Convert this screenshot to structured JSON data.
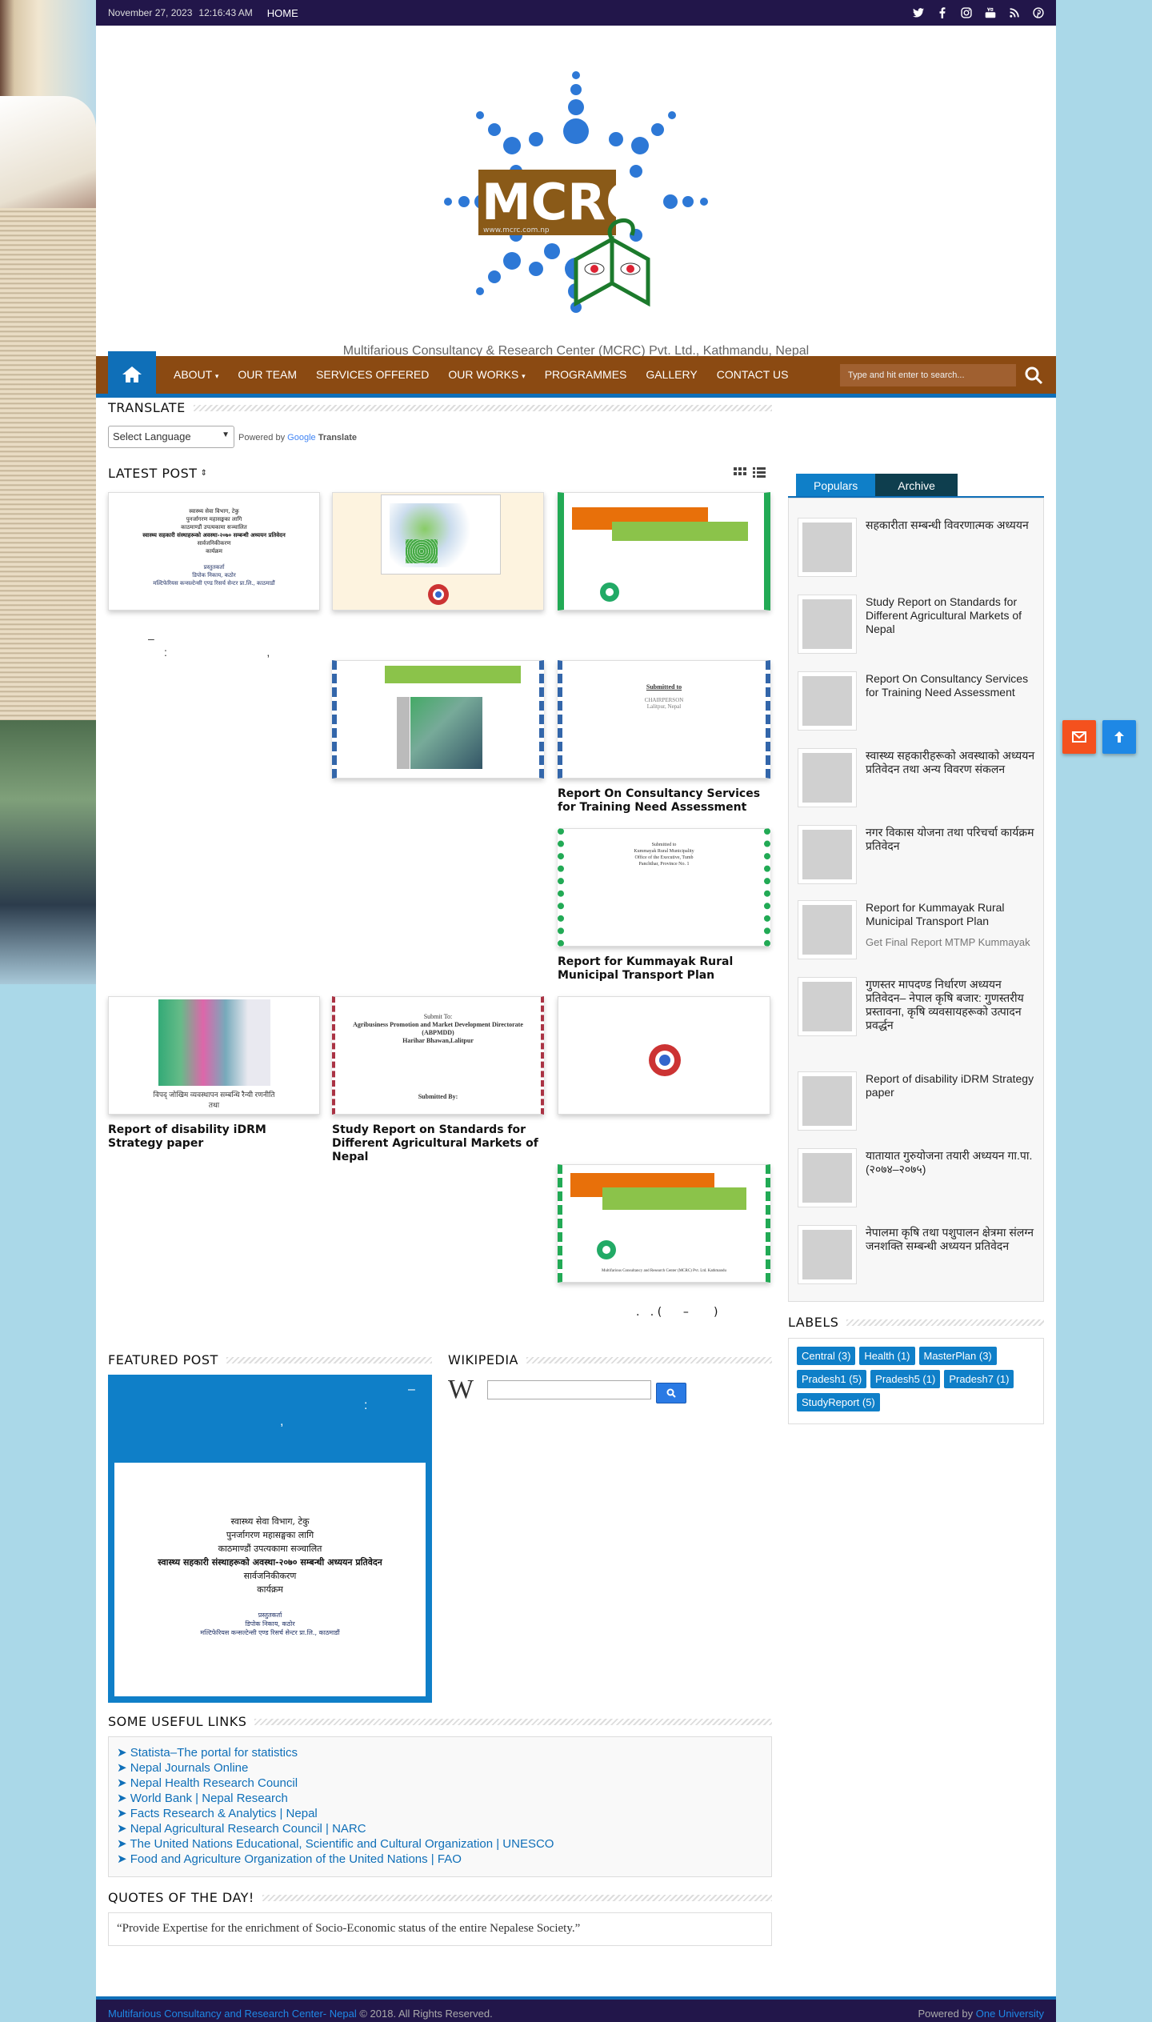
{
  "topbar": {
    "date": "November 27, 2023",
    "time": "12:16:43 AM",
    "home": "HOME"
  },
  "social": [
    "twitter-icon",
    "facebook-icon",
    "instagram-icon",
    "youtube-icon",
    "rss-icon",
    "pinterest-icon"
  ],
  "header": {
    "logo_text": "MCRC",
    "logo_url": "www.mcrc.com.np",
    "tagline": "Multifarious Consultancy & Research Center (MCRC) Pvt. Ltd., Kathmandu, Nepal"
  },
  "nav": {
    "items": [
      "ABOUT",
      "OUR TEAM",
      "SERVICES OFFERED",
      "OUR WORKS",
      "PROGRAMMES",
      "GALLERY",
      "CONTACT US"
    ],
    "search_placeholder": "Type and hit enter to search..."
  },
  "translate": {
    "title": "TRANSLATE",
    "select": "Select Language",
    "powered": "Powered by",
    "google": "Google",
    "translate": "Translate"
  },
  "latest": {
    "title": "LATEST POST"
  },
  "posts": {
    "p1_dash": "–",
    "p1_text": ":                                ,",
    "p5": "Report On Consultancy Services for Training Need Assessment",
    "p6": "Report for Kummayak Rural Municipal Transport Plan",
    "p7": "Report of disability iDRM Strategy paper",
    "p8": "Study Report on Standards for Different Agricultural Markets of Nepal",
    "p10": ".   . (      –       )"
  },
  "doc": {
    "h1": "स्वास्थ्य सेवा विभाग, टेकु",
    "h2": "पुनर्जागरण महासङ्घका लागि",
    "h3": "काठमाण्डौं उपत्यकामा सञ्चालित",
    "h4": "स्वास्थ्य सहकारी संस्थाहरूको अवस्था-२०७० सम्बन्धी अध्ययन प्रतिवेदन",
    "h5": "सार्वजनिकीकरण",
    "h6": "कार्यक्रम",
    "s1": "प्रस्तुतकर्ता",
    "s2": "डिपोक निकाय, कठोर",
    "s3": "मल्टिफेरियस कन्सल्टेन्सी एण्ड रिसर्च सेन्टर प्रा.लि., काठमाडौं",
    "sub1": "Submitted to",
    "sub2": "CHAIRPERSON",
    "sub3": "Lalitpur, Nepal",
    "kt1": "Submitted to",
    "kt2": "Kummayak Rural Municipality",
    "kt3": "Office of the Executive, Tumb",
    "kt4": "Panchthar, Province No. 1",
    "ag1": "Submit To:",
    "ag2": "Agribusiness Promotion and Market Development Directorate (ABPMDD)",
    "ag3": "Harihar Bhawan,Lalitpur",
    "ag4": "Submitted By:",
    "disab": "विपद् जोखिम व्यवस्थापन सम्बन्धि रैन्यी रणनीति",
    "disab2": "तथा",
    "mcrc_footer": "Multifarious Consultancy and Research Center (MCRC) Pvt. Ltd. Kathmandu"
  },
  "popular": {
    "tab1": "Populars",
    "tab2": "Archive",
    "items": [
      {
        "title": "सहकारीता सम्बन्धी विवरणात्मक अध्ययन"
      },
      {
        "title": "Study Report on Standards for Different Agricultural Markets of Nepal"
      },
      {
        "title": "Report On Consultancy Services for Training Need Assessment"
      },
      {
        "title": "स्वास्थ्य सहकारीहरूको अवस्थाको अध्ययन प्रतिवेदन तथा अन्य विवरण संकलन"
      },
      {
        "title": "नगर विकास योजना तथा परिचर्चा कार्यक्रम प्रतिवेदन"
      },
      {
        "title": "Report for Kummayak Rural Municipal Transport Plan",
        "sub": "Get Final Report MTMP Kummayak"
      },
      {
        "title": "गुणस्तर मापदण्ड निर्धारण अध्ययन प्रतिवेदन– नेपाल कृषि बजार: गुणस्तरीय प्रस्तावना, कृषि व्यवसायहरूको उत्पादन प्रवर्द्धन"
      },
      {
        "title": "Report of disability iDRM Strategy paper"
      },
      {
        "title": "यातायात गुरुयोजना तयारी अध्ययन गा.पा. (२०७४–२०७५)"
      },
      {
        "title": "नेपालमा कृषि तथा पशुपालन क्षेत्रमा संलग्न जनशक्ति सम्बन्धी अध्ययन प्रतिवेदन"
      }
    ]
  },
  "labels": {
    "title": "LABELS",
    "items": [
      "Central (3)",
      "Health (1)",
      "MasterPlan (3)",
      "Pradesh1 (5)",
      "Pradesh5 (1)",
      "Pradesh7 (1)",
      "StudyReport (5)"
    ]
  },
  "featured": {
    "title": "FEATURED POST",
    "overlay1": "–",
    "overlay2": ":",
    "overlay3": ","
  },
  "wiki": {
    "title": "WIKIPEDIA",
    "logo": "W"
  },
  "links": {
    "title": "SOME USEFUL LINKS",
    "items": [
      "Statista–The portal for statistics",
      "Nepal Journals Online",
      "Nepal Health Research Council",
      "World Bank | Nepal Research",
      "Facts Research & Analytics | Nepal",
      "Nepal Agricultural Research Council | NARC",
      "The United Nations Educational, Scientific and Cultural Organization | UNESCO",
      "Food and Agriculture Organization of the United Nations | FAO"
    ]
  },
  "quote": {
    "title": "QUOTES OF THE DAY!",
    "text": "“Provide Expertise for the enrichment of Socio-Economic status of the entire Nepalese Society.”"
  },
  "footer": {
    "left_link": "Multifarious Consultancy and Research Center- Nepal",
    "left_rest": " © 2018. All Rights Reserved.",
    "right_pre": "Powered by ",
    "right_link": "One University"
  },
  "colors": {
    "navbar": "#8b4a12",
    "accent": "#0f6fb8",
    "topbar": "#22164a",
    "mail_fab": "#f4511e",
    "top_fab": "#1e88e5"
  }
}
